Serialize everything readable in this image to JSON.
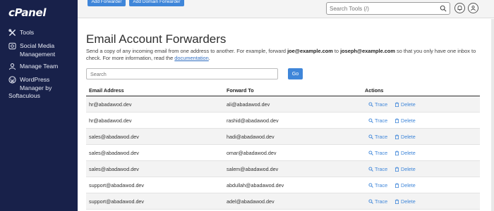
{
  "app": {
    "logo": "cPanel"
  },
  "sidebar": {
    "items": [
      {
        "label": "Tools",
        "icon": "tools-icon"
      },
      {
        "label": "Social Media",
        "label2": "Management",
        "icon": "social-media-icon"
      },
      {
        "label": "Manage Team",
        "icon": "team-icon"
      },
      {
        "label": "WordPress",
        "label2": "Manager by",
        "label3": "Softaculous",
        "icon": "wordpress-icon"
      }
    ]
  },
  "topbar": {
    "button1": "Add Forwarder",
    "button2": "Add Domain Forwarder",
    "search_placeholder": "Search Tools (/)"
  },
  "main": {
    "title": "Email Account Forwarders",
    "desc_part1": "Send a copy of any incoming email from one address to another. For example, forward ",
    "desc_example1": "joe@example.com",
    "desc_part2": " to ",
    "desc_example2": "joseph@example.com",
    "desc_part3": " so that you only have one inbox to check. For more information, read the ",
    "desc_link": "documentation",
    "desc_end": ".",
    "search_placeholder": "Search",
    "go_label": "Go"
  },
  "table": {
    "headers": {
      "email": "Email Address",
      "forward": "Forward To",
      "actions": "Actions"
    },
    "trace_label": "Trace",
    "delete_label": "Delete",
    "rows": [
      {
        "email": "hr@abadawod.dev",
        "forward": "ali@abadawod.dev"
      },
      {
        "email": "hr@abadawod.dev",
        "forward": "rashid@abadawod.dev"
      },
      {
        "email": "sales@abadawod.dev",
        "forward": "hadi@abadawod.dev"
      },
      {
        "email": "sales@abadawod.dev",
        "forward": "omar@abadawod.dev"
      },
      {
        "email": "sales@abadawod.dev",
        "forward": "salem@abadawod.dev"
      },
      {
        "email": "support@abadawod.dev",
        "forward": "abdullah@abadawod.dev"
      },
      {
        "email": "support@abadawod.dev",
        "forward": "adel@abadawod.dev"
      }
    ]
  },
  "colors": {
    "sidebar": "#18214a",
    "accent": "#3f86d9",
    "link": "#2f6dc0"
  }
}
